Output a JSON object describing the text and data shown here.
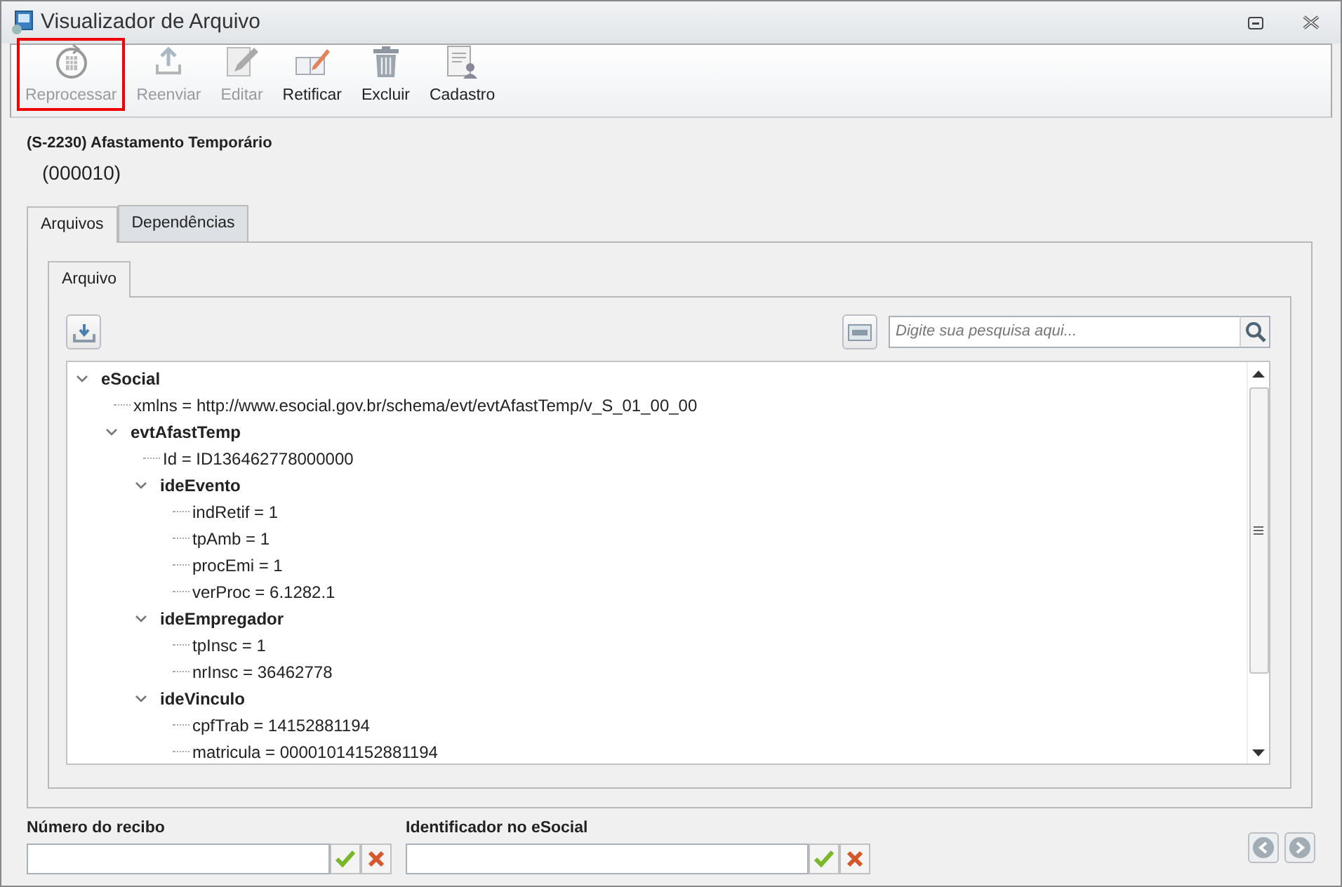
{
  "window": {
    "title": "Visualizador de Arquivo"
  },
  "toolbar": [
    {
      "label": "Reprocessar",
      "disabled": true,
      "highlighted": true
    },
    {
      "label": "Reenviar",
      "disabled": true,
      "highlighted": false
    },
    {
      "label": "Editar",
      "disabled": true,
      "highlighted": false
    },
    {
      "label": "Retificar",
      "disabled": false,
      "highlighted": false
    },
    {
      "label": "Excluir",
      "disabled": false,
      "highlighted": false
    },
    {
      "label": "Cadastro",
      "disabled": false,
      "highlighted": false
    }
  ],
  "header": {
    "title": "(S-2230) Afastamento Temporário",
    "code": "(000010)"
  },
  "tabs": [
    {
      "label": "Arquivos",
      "selected": true
    },
    {
      "label": "Dependências",
      "selected": false
    }
  ],
  "inner_tabs": [
    {
      "label": "Arquivo",
      "selected": true
    }
  ],
  "search": {
    "placeholder": "Digite sua pesquisa aqui..."
  },
  "tree": [
    {
      "text": "eSocial",
      "kind": "group",
      "expanded": true,
      "children": [
        {
          "text": "xmlns = http://www.esocial.gov.br/schema/evt/evtAfastTemp/v_S_01_00_00",
          "kind": "attr"
        },
        {
          "text": "evtAfastTemp",
          "kind": "group",
          "expanded": true,
          "children": [
            {
              "text": "Id = ID136462778000000",
              "kind": "attr"
            },
            {
              "text": "ideEvento",
              "kind": "group",
              "expanded": true,
              "children": [
                {
                  "text": "indRetif = 1",
                  "kind": "attr"
                },
                {
                  "text": "tpAmb = 1",
                  "kind": "attr"
                },
                {
                  "text": "procEmi = 1",
                  "kind": "attr"
                },
                {
                  "text": "verProc = 6.1282.1",
                  "kind": "attr"
                }
              ]
            },
            {
              "text": "ideEmpregador",
              "kind": "group",
              "expanded": true,
              "children": [
                {
                  "text": "tpInsc = 1",
                  "kind": "attr"
                },
                {
                  "text": "nrInsc = 36462778",
                  "kind": "attr"
                }
              ]
            },
            {
              "text": "ideVinculo",
              "kind": "group",
              "expanded": true,
              "children": [
                {
                  "text": "cpfTrab = 14152881194",
                  "kind": "attr"
                },
                {
                  "text": "matricula = 00001014152881194",
                  "kind": "attr"
                }
              ]
            }
          ]
        }
      ]
    }
  ],
  "fields": [
    {
      "label": "Número do recibo"
    },
    {
      "label": "Identificador no eSocial"
    }
  ]
}
